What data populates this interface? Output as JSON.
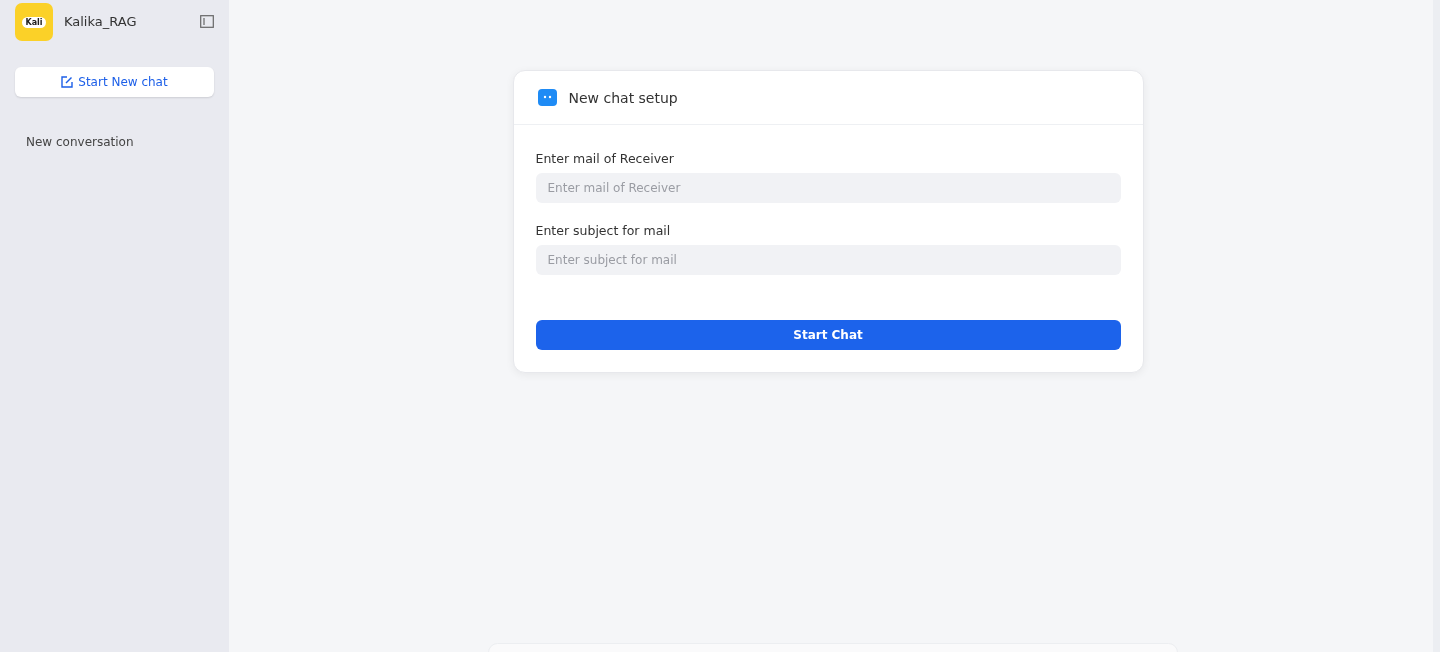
{
  "sidebar": {
    "logo_text": "Kali",
    "app_name": "Kalika_RAG",
    "new_chat_button": "Start New chat",
    "conversations": [
      {
        "title": "New conversation"
      }
    ]
  },
  "setup_card": {
    "title": "New chat setup",
    "fields": [
      {
        "label": "Enter mail of Receiver",
        "placeholder": "Enter mail of Receiver"
      },
      {
        "label": "Enter subject for mail",
        "placeholder": "Enter subject for mail"
      }
    ],
    "submit_button": "Start Chat"
  }
}
